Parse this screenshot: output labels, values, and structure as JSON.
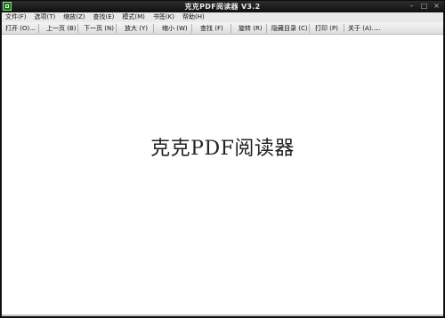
{
  "window": {
    "title": "克克PDF阅读器 V3.2"
  },
  "menu": [
    {
      "label": "文件(F)"
    },
    {
      "label": "选项(T)"
    },
    {
      "label": "缩放(Z)"
    },
    {
      "label": "查找(E)"
    },
    {
      "label": "模式(M)"
    },
    {
      "label": "书签(K)"
    },
    {
      "label": "帮助(H)"
    }
  ],
  "toolbar": {
    "open": "打开 (O)...",
    "prev": "上一页 (B)",
    "next": "下一页 (N)",
    "zoom_in": "放大 (Y)",
    "zoom_out": "缩小 (W)",
    "find": "查找 (F)",
    "rotate": "旋转 (R)",
    "toc": "隐藏目录 (C)",
    "print": "打印 (P)",
    "about": "关于 (A)...",
    "overflow": ".."
  },
  "content": {
    "splash_title": "克克PDF阅读器"
  },
  "icons": [
    "app-icon",
    "minimize-icon",
    "maximize-icon",
    "close-icon"
  ]
}
